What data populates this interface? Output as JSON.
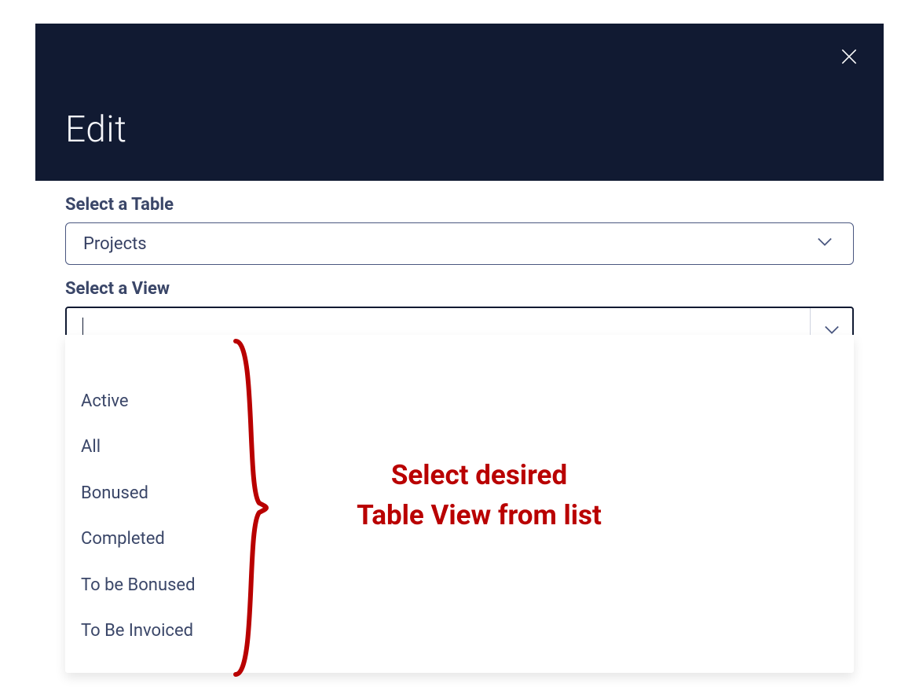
{
  "modal": {
    "title": "Edit"
  },
  "fields": {
    "table_label": "Select a Table",
    "table_value": "Projects",
    "view_label": "Select a View",
    "view_value": ""
  },
  "dropdown": {
    "options": [
      "",
      "Active",
      "All",
      "Bonused",
      "Completed",
      "To be Bonused",
      "To Be Invoiced"
    ]
  },
  "annotation": {
    "line1": "Select desired",
    "line2": "Table View from list"
  }
}
